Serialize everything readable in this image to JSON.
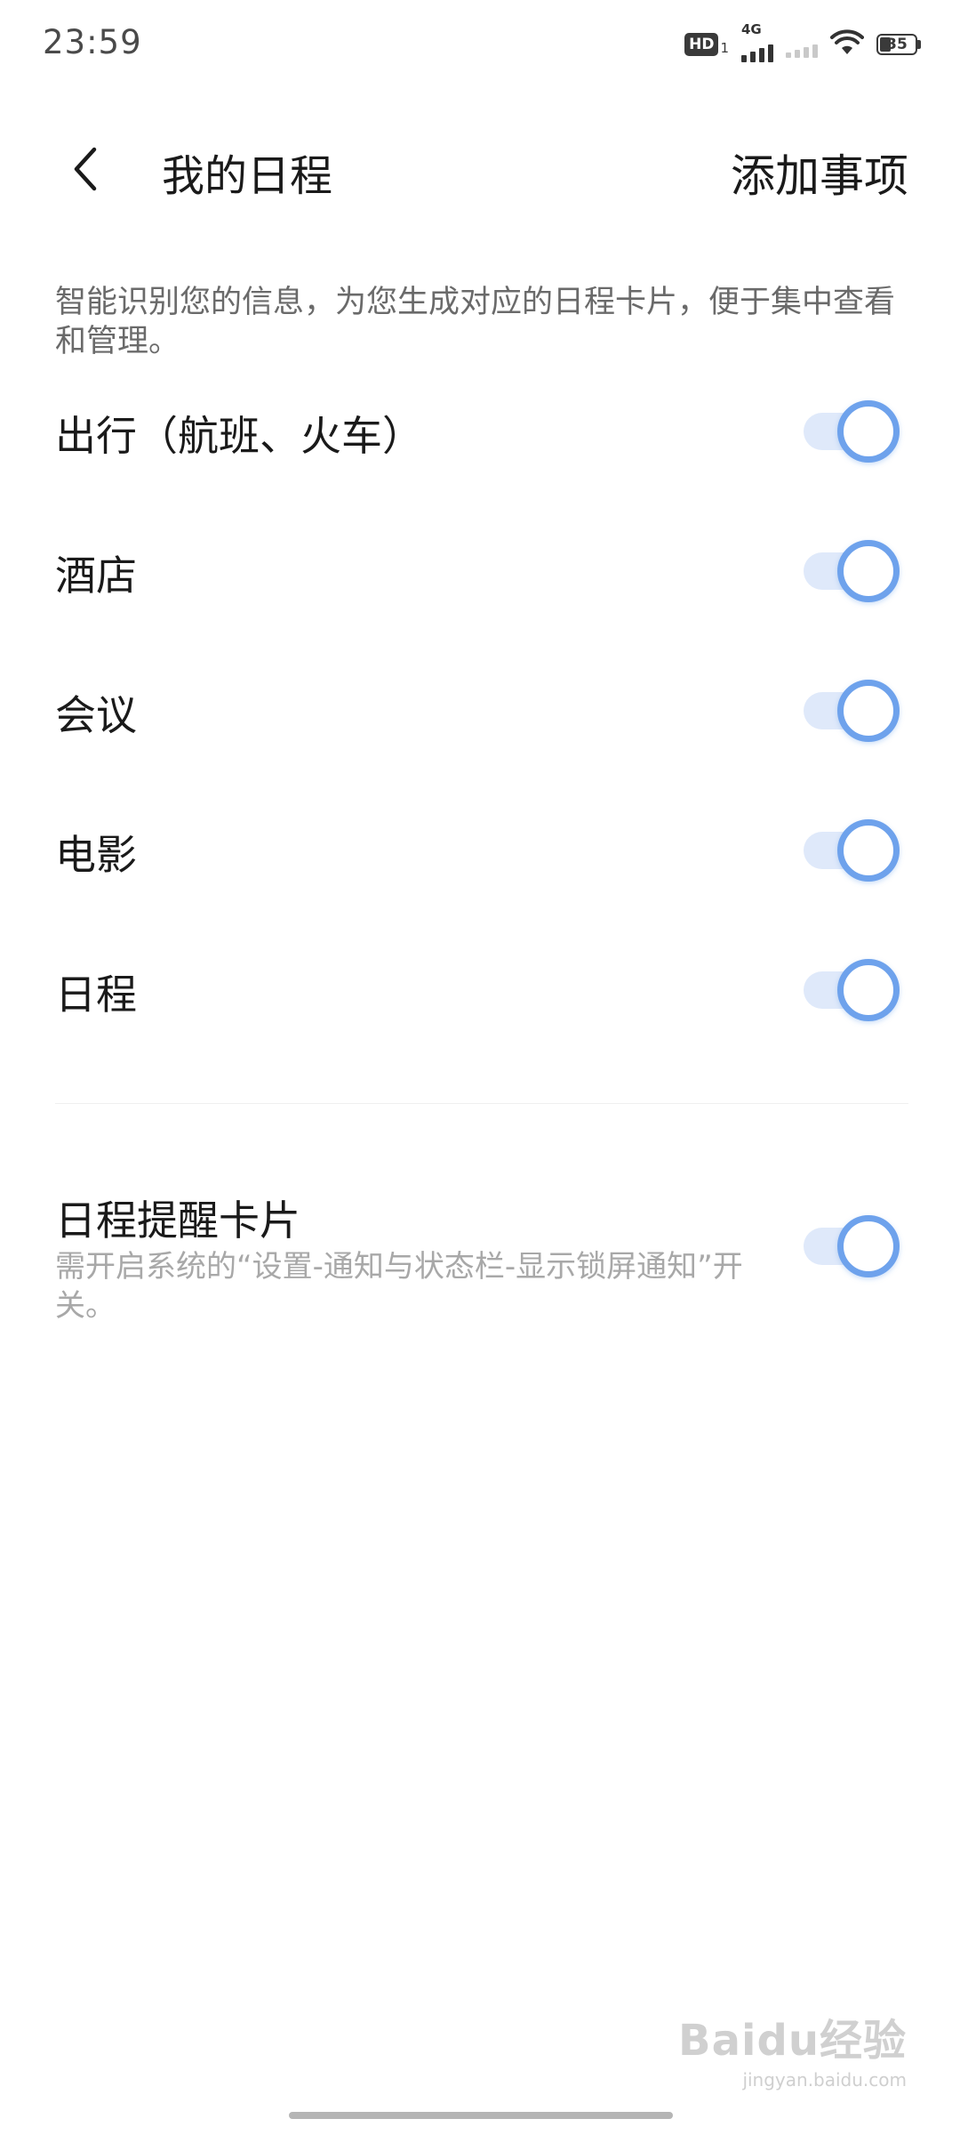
{
  "status_bar": {
    "time": "23:59",
    "hd_label": "HD",
    "hd_sub": "1",
    "network_label": "4G",
    "battery_level": "35"
  },
  "header": {
    "title": "我的日程",
    "action_label": "添加事项"
  },
  "description": "智能识别您的信息，为您生成对应的日程卡片，便于集中查看和管理。",
  "settings": [
    {
      "label": "出行（航班、火车）",
      "enabled": true
    },
    {
      "label": "酒店",
      "enabled": true
    },
    {
      "label": "会议",
      "enabled": true
    },
    {
      "label": "电影",
      "enabled": true
    },
    {
      "label": "日程",
      "enabled": true
    }
  ],
  "reminder_card": {
    "title": "日程提醒卡片",
    "subtitle": "需开启系统的“设置-通知与状态栏-显示锁屏通知”开关。",
    "enabled": true
  },
  "watermark": {
    "logo": "Baidu经验",
    "url": "jingyan.baidu.com"
  },
  "colors": {
    "toggle_on": "#6ea2ec",
    "toggle_track": "#dfe9fa"
  }
}
